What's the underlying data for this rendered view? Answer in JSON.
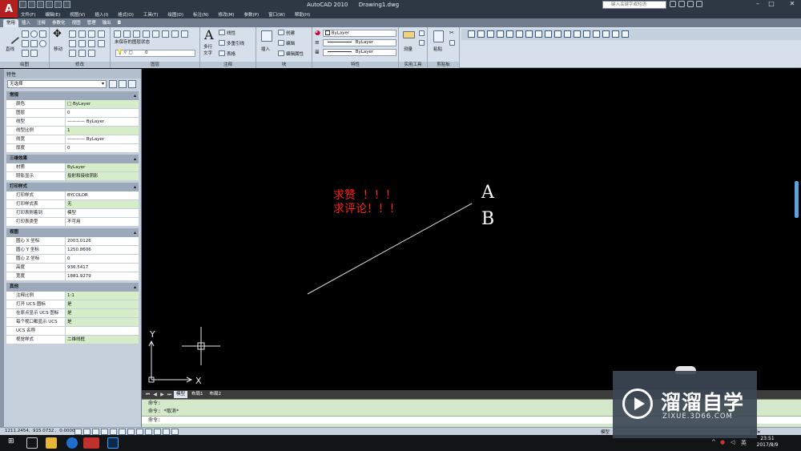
{
  "window": {
    "title": "AutoCAD 2010      Drawing1.dwg",
    "search_placeholder": "键入关键字或短语",
    "app_letter": "A",
    "min": "–",
    "max": "□",
    "close": "✕"
  },
  "menu": [
    "文件(F)",
    "编辑(E)",
    "视图(V)",
    "插入(I)",
    "格式(O)",
    "工具(T)",
    "绘图(D)",
    "标注(N)",
    "修改(M)",
    "参数(P)",
    "窗口(W)",
    "帮助(H)"
  ],
  "ribbon_tabs": [
    "常用",
    "插入",
    "注释",
    "参数化",
    "视图",
    "管理",
    "输出",
    "◘"
  ],
  "ribbon": {
    "panels": [
      "绘图",
      "修改",
      "图层",
      "注释",
      "块",
      "特性",
      "实用工具",
      "剪贴板"
    ],
    "line": "直线",
    "move": "移动",
    "layer_state": "未保存的图层状态",
    "layer_name": "0",
    "multiline_text": "多行\n文字",
    "linear": "线性",
    "multileader": "多重引线",
    "table": "表格",
    "insert": "插入",
    "create": "创建",
    "edit": "编辑",
    "edit_attr": "编辑属性",
    "color_combo": "ByLayer",
    "linetype_combo": "ByLayer",
    "lineweight_combo": "ByLayer",
    "measure": "测量",
    "paste": "粘贴"
  },
  "palette": {
    "title": "特性",
    "selection": "无选择",
    "sections": [
      {
        "name": "常规",
        "rows": [
          [
            "颜色",
            "□ ByLayer",
            true
          ],
          [
            "图层",
            "0",
            false
          ],
          [
            "线型",
            "———— ByLayer",
            false
          ],
          [
            "线型比例",
            "1",
            true
          ],
          [
            "线宽",
            "———— ByLayer",
            false
          ],
          [
            "厚度",
            "0",
            false
          ]
        ]
      },
      {
        "name": "三维效果",
        "rows": [
          [
            "材质",
            "ByLayer",
            true
          ],
          [
            "阴影显示",
            "投射和接收阴影",
            true
          ]
        ]
      },
      {
        "name": "打印样式",
        "rows": [
          [
            "打印样式",
            "BYCOLOR",
            false
          ],
          [
            "打印样式表",
            "无",
            true
          ],
          [
            "打印表附着到",
            "模型",
            false
          ],
          [
            "打印表类型",
            "不可用",
            false
          ]
        ]
      },
      {
        "name": "视图",
        "rows": [
          [
            "圆心 X 坐标",
            "2003.0126",
            false
          ],
          [
            "圆心 Y 坐标",
            "1250.8606",
            false
          ],
          [
            "圆心 Z 坐标",
            "0",
            false
          ],
          [
            "高度",
            "936.5417",
            false
          ],
          [
            "宽度",
            "1881.9279",
            false
          ]
        ]
      },
      {
        "name": "其他",
        "rows": [
          [
            "注释比例",
            "1:1",
            true
          ],
          [
            "打开 UCS 图标",
            "是",
            true
          ],
          [
            "在原点显示 UCS 图标",
            "是",
            true
          ],
          [
            "每个视口都显示 UCS",
            "是",
            true
          ],
          [
            "UCS 名称",
            "",
            false
          ],
          [
            "视觉样式",
            "二维线框",
            true
          ]
        ]
      }
    ]
  },
  "canvas": {
    "red_line1": "求赞  ！！！",
    "red_line2": "求评论！！！",
    "letter_a": "A",
    "letter_b": "B",
    "ucs_x": "X",
    "ucs_y": "Y"
  },
  "layout_tabs": [
    "模型",
    "布局1",
    "布局2"
  ],
  "command": {
    "line1": "命令:",
    "line2": "命令: *取消*",
    "prompt": "命令:"
  },
  "status": {
    "coords": "1211.2454,  915.0732 ,  0.0000",
    "model": "模型",
    "annotation": "注释▾"
  },
  "taskbar": {
    "time": "23:51",
    "date": "2017/8/9",
    "ime": "英"
  },
  "watermark": {
    "brand": "溜溜自学",
    "url": "ZIXUE.3D66.COM"
  },
  "colors": {
    "accent_red": "#ff2020",
    "cmd_green": "#d3e9c9",
    "prop_green": "#d6edc9"
  }
}
